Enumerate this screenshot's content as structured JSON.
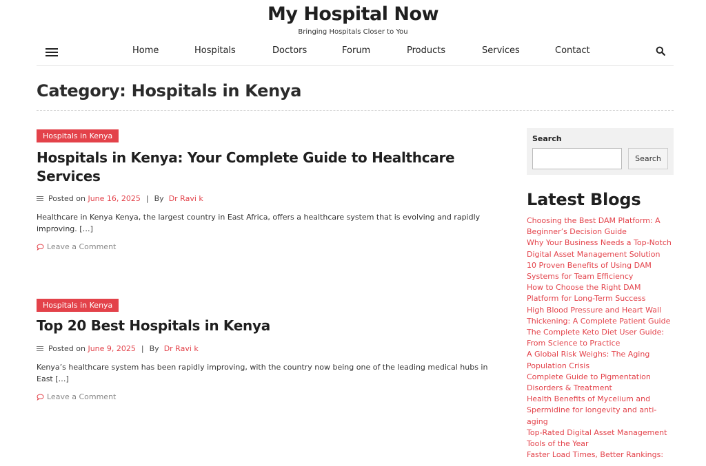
{
  "header": {
    "site_title": "My Hospital Now",
    "tagline": "Bringing Hospitals Closer to You"
  },
  "nav": {
    "items": [
      "Home",
      "Hospitals",
      "Doctors",
      "Forum",
      "Products",
      "Services",
      "Contact"
    ]
  },
  "page": {
    "category_title": "Category: Hospitals in Kenya"
  },
  "posts": [
    {
      "category": "Hospitals in Kenya",
      "title": "Hospitals in Kenya: Your Complete Guide to Healthcare Services",
      "posted_label": "Posted on",
      "date": "June 16, 2025",
      "by_label": "By",
      "author": "Dr Ravi k",
      "excerpt": "Healthcare in Kenya Kenya, the largest country in East Africa, offers a healthcare system that is evolving and rapidly improving. […]",
      "comment_label": "Leave a Comment"
    },
    {
      "category": "Hospitals in Kenya",
      "title": "Top 20 Best Hospitals in Kenya",
      "posted_label": "Posted on",
      "date": "June 9, 2025",
      "by_label": "By",
      "author": "Dr Ravi k",
      "excerpt": "Kenya’s healthcare system has been rapidly improving, with the country now being one of the leading medical hubs in East […]",
      "comment_label": "Leave a Comment"
    }
  ],
  "sidebar": {
    "search_label": "Search",
    "search_value": "",
    "search_button": "Search",
    "latest_title": "Latest Blogs",
    "latest_items": [
      "Choosing the Best DAM Platform: A Beginner’s Decision Guide",
      "Why Your Business Needs a Top-Notch Digital Asset Management Solution",
      "10 Proven Benefits of Using DAM Systems for Team Efficiency",
      "How to Choose the Right DAM Platform for Long-Term Success",
      "High Blood Pressure and Heart Wall Thickening: A Complete Patient Guide",
      "The Complete Keto Diet User Guide: From Science to Practice",
      "A Global Risk Weighs: The Aging Population Crisis",
      "Complete Guide to Pigmentation Disorders & Treatment",
      "Health Benefits of Mycelium and Spermidine for longevity and anti-aging",
      "Top-Rated Digital Asset Management Tools of the Year",
      "Faster Load Times, Better Rankings:"
    ]
  },
  "colors": {
    "accent": "#e3424a",
    "text": "#222222",
    "muted": "#888888",
    "sidebar_bg": "#f1f1f1"
  },
  "icons": {
    "menu": "hamburger-icon",
    "search": "search-icon",
    "meta": "list-icon",
    "comment": "speech-bubble-icon"
  }
}
